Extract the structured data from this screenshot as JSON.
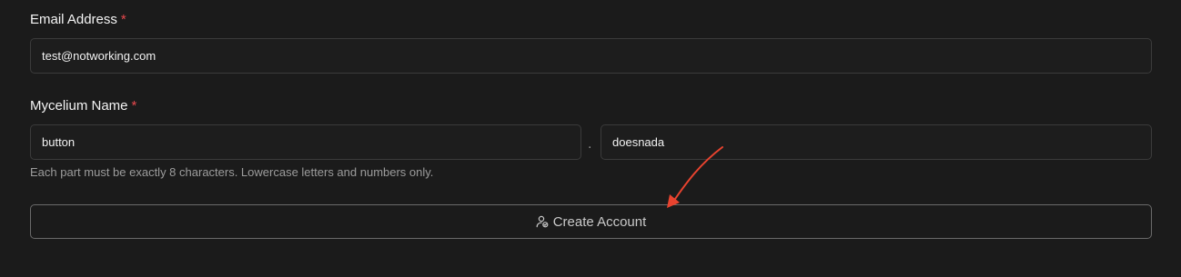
{
  "email": {
    "label": "Email Address",
    "required_mark": "*",
    "value": "test@notworking.com"
  },
  "mycelium": {
    "label": "Mycelium Name",
    "required_mark": "*",
    "part1_value": "button",
    "separator": ".",
    "part2_value": "doesnada",
    "helper": "Each part must be exactly 8 characters. Lowercase letters and numbers only."
  },
  "submit": {
    "label": "Create Account",
    "icon": "user-check-icon"
  },
  "colors": {
    "background": "#1b1b1b",
    "required": "#e5484d",
    "annotation_arrow": "#e8432f"
  }
}
